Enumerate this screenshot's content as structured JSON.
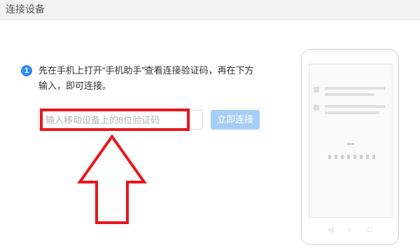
{
  "window": {
    "title": "连接设备"
  },
  "step": {
    "number": "1"
  },
  "instruction": {
    "text": "先在手机上打开“手机助手”查看连接验证码，再在下方输入，即可连接。"
  },
  "code_input": {
    "placeholder": "输入移动设备上的8位验证码",
    "value": ""
  },
  "connect_button": {
    "label": "立即连接"
  },
  "phone_nav": {
    "back": "◁",
    "home": "○",
    "recent": "□"
  },
  "colors": {
    "accent": "#2d8cf0",
    "button_disabled": "#a6cdf7",
    "highlight": "#e8161d"
  }
}
